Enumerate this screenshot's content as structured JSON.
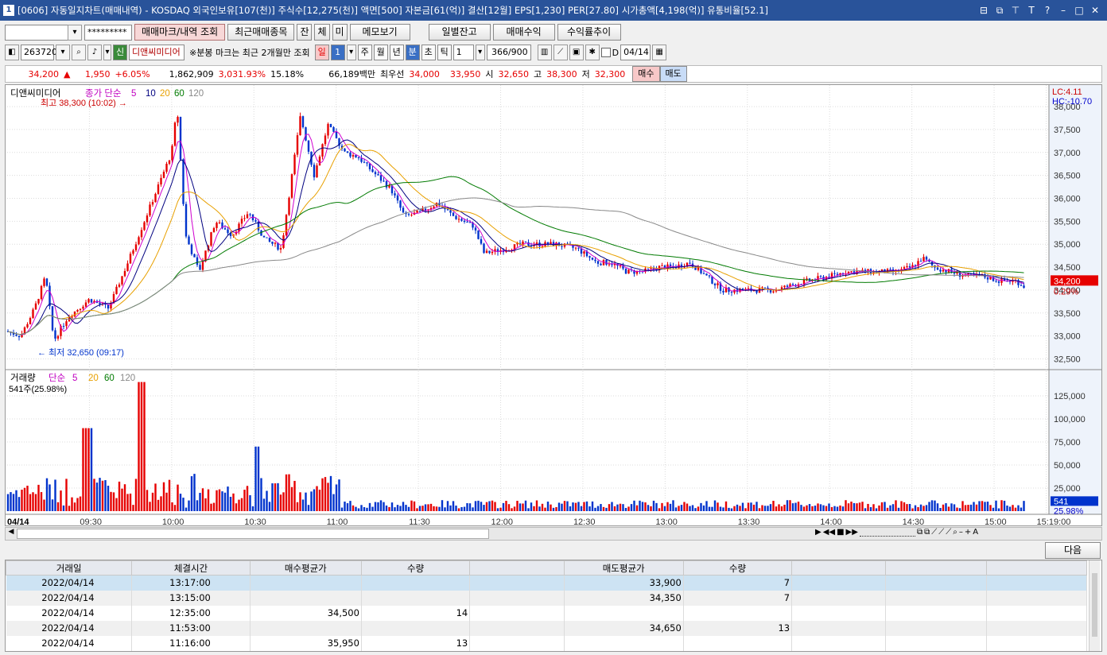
{
  "window": {
    "number": "1",
    "title": "[0606] 자동일지차트(매매내역) - KOSDAQ 외국인보유[107(천)] 주식수[12,275(천)] 액면[500] 자본금[61(억)] 결산[12월] EPS[1,230] PER[27.80] 시가총액[4,198(억)] 유통비율[52.1]",
    "icons": [
      "restore-icon",
      "copy-icon",
      "pin-icon",
      "font-icon",
      "help-icon",
      "minimize-icon",
      "maximize-icon",
      "close-icon"
    ]
  },
  "toolbar1": {
    "account_value": "",
    "password_mask": "*********",
    "btn_trade_mark": "매매마크/내역 조회",
    "btn_recent_items": "최근매매종목",
    "btn_jan": "잔",
    "btn_che": "체",
    "btn_mi": "미",
    "btn_memo": "메모보기",
    "btn_daily_balance": "일별잔고",
    "btn_trade_profit": "매매수익",
    "btn_return_trend": "수익률추이"
  },
  "toolbar2": {
    "code": "263720",
    "credit_badge": "신",
    "stock_name": "디앤씨미디어",
    "notice": "※분봉 마크는 최근 2개월만 조회",
    "period_day": "일",
    "period_num": "1",
    "period_week": "주",
    "period_month": "월",
    "period_year": "년",
    "period_min": "분",
    "period_sec": "초",
    "period_tick": "틱",
    "interval": "1",
    "count": "366/900",
    "checkbox_d": "D",
    "date": "04/14"
  },
  "quote": {
    "price": "34,200",
    "arrow": "▲",
    "change": "1,950",
    "rate": "+6.05%",
    "volume": "1,862,909",
    "volume_ratio": "3,031.93%",
    "turnover": "15.18%",
    "amount": "66,189백만",
    "best_label": "최우선",
    "ask": "34,000",
    "bid": "33,950",
    "open_label": "시",
    "open": "32,650",
    "high_label": "고",
    "high": "38,300",
    "low_label": "저",
    "low": "32,300",
    "buy_btn": "매수",
    "sell_btn": "매도"
  },
  "chart_data": {
    "type": "candlestick",
    "price_legend": {
      "name": "디앤씨미디어",
      "ma_label": "종가 단순",
      "ma": [
        "5",
        "10",
        "20",
        "60",
        "120"
      ]
    },
    "high_note": "최고 38,300 (10:02)",
    "low_note": "최저 32,650 (09:17)",
    "lc": "LC:4.11",
    "hc": "HC:-10.70",
    "current_price_label": "34,200",
    "current_pct_label": "0.29%",
    "y_ticks": [
      "38,000",
      "37,500",
      "37,000",
      "36,500",
      "36,000",
      "35,500",
      "35,000",
      "34,500",
      "34,000",
      "33,500",
      "33,000",
      "32,500"
    ],
    "ylim": [
      32300,
      38400
    ],
    "volume_legend": {
      "name": "거래량",
      "ma_label": "단순",
      "ma": [
        "5",
        "20",
        "60",
        "120"
      ]
    },
    "volume_note": "541주(25.98%)",
    "vol_ticks": [
      "125,000",
      "100,000",
      "75,000",
      "50,000",
      "25,000"
    ],
    "vol_current": "541",
    "vol_pct": "25.98%",
    "x_date": "04/14",
    "x_ticks": [
      "09:30",
      "10:00",
      "10:30",
      "11:00",
      "11:30",
      "12:00",
      "12:30",
      "13:00",
      "13:30",
      "14:00",
      "14:30",
      "15:00",
      "15:19:00"
    ],
    "close_path": [
      [
        "09:00",
        33100
      ],
      [
        "09:05",
        33000
      ],
      [
        "09:10",
        33600
      ],
      [
        "09:14",
        34300
      ],
      [
        "09:17",
        32900
      ],
      [
        "09:22",
        33400
      ],
      [
        "09:30",
        33800
      ],
      [
        "09:37",
        33600
      ],
      [
        "09:44",
        34600
      ],
      [
        "09:52",
        35800
      ],
      [
        "10:00",
        37000
      ],
      [
        "10:02",
        38000
      ],
      [
        "10:05",
        35200
      ],
      [
        "10:10",
        34400
      ],
      [
        "10:16",
        35500
      ],
      [
        "10:22",
        35200
      ],
      [
        "10:28",
        35700
      ],
      [
        "10:34",
        35100
      ],
      [
        "10:40",
        34900
      ],
      [
        "10:47",
        37800
      ],
      [
        "10:52",
        36500
      ],
      [
        "10:57",
        37600
      ],
      [
        "11:03",
        37000
      ],
      [
        "11:08",
        36900
      ],
      [
        "11:13",
        36600
      ],
      [
        "11:20",
        36200
      ],
      [
        "11:25",
        35600
      ],
      [
        "11:31",
        35700
      ],
      [
        "11:37",
        35900
      ],
      [
        "11:43",
        35600
      ],
      [
        "11:50",
        35400
      ],
      [
        "11:54",
        34800
      ],
      [
        "12:02",
        34900
      ],
      [
        "12:08",
        35000
      ],
      [
        "12:14",
        35000
      ],
      [
        "12:20",
        35000
      ],
      [
        "12:28",
        34900
      ],
      [
        "12:35",
        34600
      ],
      [
        "12:40",
        34600
      ],
      [
        "12:46",
        34400
      ],
      [
        "12:52",
        34400
      ],
      [
        "12:58",
        34500
      ],
      [
        "13:03",
        34500
      ],
      [
        "13:09",
        34600
      ],
      [
        "13:15",
        34300
      ],
      [
        "13:21",
        34000
      ],
      [
        "13:27",
        34000
      ],
      [
        "13:34",
        34000
      ],
      [
        "13:40",
        34000
      ],
      [
        "13:46",
        34100
      ],
      [
        "13:52",
        34200
      ],
      [
        "14:00",
        34300
      ],
      [
        "14:06",
        34400
      ],
      [
        "14:12",
        34400
      ],
      [
        "14:18",
        34400
      ],
      [
        "14:24",
        34400
      ],
      [
        "14:30",
        34500
      ],
      [
        "14:34",
        34700
      ],
      [
        "14:38",
        34500
      ],
      [
        "14:44",
        34400
      ],
      [
        "14:50",
        34300
      ],
      [
        "14:56",
        34300
      ],
      [
        "15:02",
        34200
      ],
      [
        "15:08",
        34200
      ],
      [
        "15:13",
        34000
      ],
      [
        "15:19",
        34200
      ]
    ]
  },
  "scroll": {
    "next_btn": "다음"
  },
  "trade_table": {
    "headers": [
      "거래일",
      "체결시간",
      "매수평균가",
      "수량",
      "",
      "매도평균가",
      "수량",
      "",
      "",
      ""
    ],
    "rows": [
      [
        "2022/04/14",
        "13:17:00",
        "",
        "",
        "",
        "33,900",
        "7",
        "",
        "",
        ""
      ],
      [
        "2022/04/14",
        "13:15:00",
        "",
        "",
        "",
        "34,350",
        "7",
        "",
        "",
        ""
      ],
      [
        "2022/04/14",
        "12:35:00",
        "34,500",
        "14",
        "",
        "",
        "",
        "",
        "",
        ""
      ],
      [
        "2022/04/14",
        "11:53:00",
        "",
        "",
        "",
        "34,650",
        "13",
        "",
        "",
        ""
      ],
      [
        "2022/04/14",
        "11:16:00",
        "35,950",
        "13",
        "",
        "",
        "",
        "",
        "",
        ""
      ]
    ]
  }
}
